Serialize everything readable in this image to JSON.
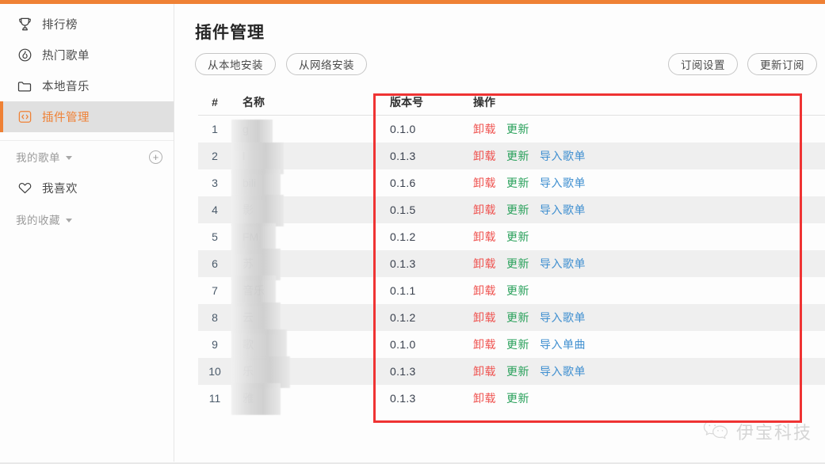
{
  "theme": {
    "accent": "#ef8135",
    "annotation_red": "#ef3333",
    "uninstall_red": "#ef5350",
    "update_green": "#28a05a",
    "import_blue": "#3f8fd0",
    "active_bg": "#e0e0e0",
    "stripe_bg": "#efefef"
  },
  "sidebar": {
    "items": [
      {
        "label": "排行榜",
        "icon": "trophy-icon",
        "active": false
      },
      {
        "label": "热门歌单",
        "icon": "flame-icon",
        "active": false
      },
      {
        "label": "本地音乐",
        "icon": "folder-icon",
        "active": false
      },
      {
        "label": "插件管理",
        "icon": "code-brackets-icon",
        "active": true
      }
    ],
    "my_playlists": {
      "label": "我的歌单",
      "caret": "chevron-down-icon",
      "add_icon": "plus-circle-icon"
    },
    "favorite": {
      "label": "我喜欢",
      "icon": "heart-icon"
    },
    "collection": {
      "label": "我的收藏",
      "caret": "chevron-down-icon"
    }
  },
  "main": {
    "title": "插件管理",
    "left_buttons": [
      {
        "label": "从本地安装"
      },
      {
        "label": "从网络安装"
      }
    ],
    "right_buttons": [
      {
        "label": "订阅设置"
      },
      {
        "label": "更新订阅"
      }
    ]
  },
  "table": {
    "headers": [
      "#",
      "名称",
      "版本号",
      "操作"
    ],
    "ops": {
      "uninstall": "卸载",
      "update": "更新",
      "import_playlist": "导入歌单",
      "import_song": "导入单曲"
    },
    "rows": [
      {
        "num": "1",
        "name": "g",
        "version": "0.1.0",
        "ops": [
          "卸载",
          "更新"
        ]
      },
      {
        "num": "2",
        "name": "l",
        "version": "0.1.3",
        "ops": [
          "卸载",
          "更新",
          "导入歌单"
        ]
      },
      {
        "num": "3",
        "name": "bili",
        "version": "0.1.6",
        "ops": [
          "卸载",
          "更新",
          "导入歌单"
        ]
      },
      {
        "num": "4",
        "name": "影",
        "version": "0.1.5",
        "ops": [
          "卸载",
          "更新",
          "导入歌单"
        ]
      },
      {
        "num": "5",
        "name": "FM",
        "version": "0.1.2",
        "ops": [
          "卸载",
          "更新"
        ]
      },
      {
        "num": "6",
        "name": "苏",
        "version": "0.1.3",
        "ops": [
          "卸载",
          "更新",
          "导入歌单"
        ]
      },
      {
        "num": "7",
        "name": "音乐",
        "version": "0.1.1",
        "ops": [
          "卸载",
          "更新"
        ]
      },
      {
        "num": "8",
        "name": "云",
        "version": "0.1.2",
        "ops": [
          "卸载",
          "更新",
          "导入歌单"
        ]
      },
      {
        "num": "9",
        "name": "歌",
        "version": "0.1.0",
        "ops": [
          "卸载",
          "更新",
          "导入单曲"
        ]
      },
      {
        "num": "10",
        "name": "乐",
        "version": "0.1.3",
        "ops": [
          "卸载",
          "更新",
          "导入歌单"
        ]
      },
      {
        "num": "11",
        "name": "雅",
        "version": "0.1.3",
        "ops": [
          "卸载",
          "更新"
        ]
      }
    ]
  },
  "watermark": {
    "text": "伊宝科技",
    "icon": "wechat-icon"
  }
}
